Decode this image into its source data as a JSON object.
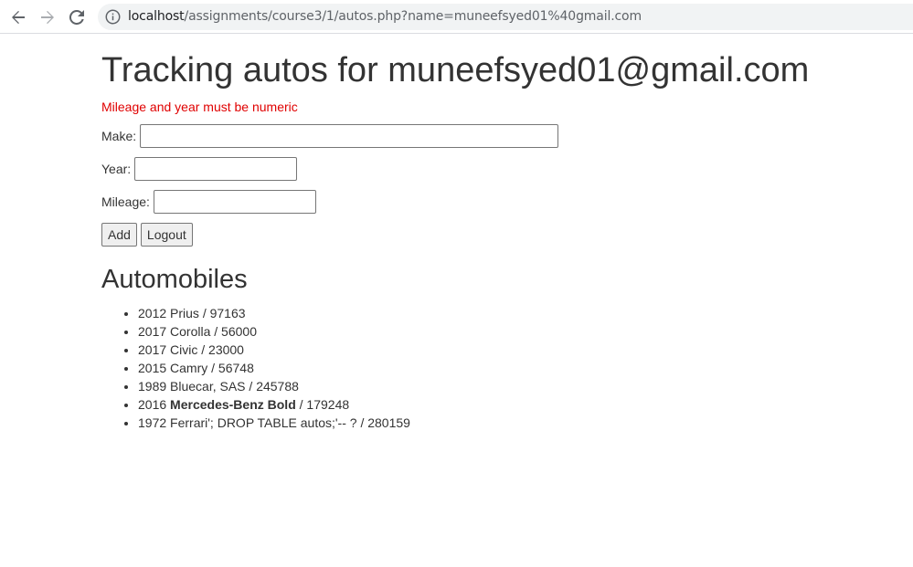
{
  "browser": {
    "url_host": "localhost",
    "url_path": "/assignments/course3/1/autos.php?name=muneefsyed01%40gmail.com"
  },
  "page": {
    "title": "Tracking autos for muneefsyed01@gmail.com",
    "error_message": "Mileage and year must be numeric",
    "error_color": "#e00000"
  },
  "form": {
    "make_label": "Make:",
    "make_value": "",
    "year_label": "Year:",
    "year_value": "",
    "mileage_label": "Mileage:",
    "mileage_value": "",
    "add_button": "Add",
    "logout_button": "Logout"
  },
  "automobiles": {
    "heading": "Automobiles",
    "items": [
      {
        "before": "2012 Prius / 97163",
        "bold": "",
        "after": ""
      },
      {
        "before": "2017 Corolla / 56000",
        "bold": "",
        "after": ""
      },
      {
        "before": "2017 Civic / 23000",
        "bold": "",
        "after": ""
      },
      {
        "before": "2015 Camry / 56748",
        "bold": "",
        "after": ""
      },
      {
        "before": "1989 Bluecar, SAS / 245788",
        "bold": "",
        "after": ""
      },
      {
        "before": "2016 ",
        "bold": "Mercedes-Benz Bold",
        "after": " / 179248"
      },
      {
        "before": "1972 Ferrari'; DROP TABLE autos;'-- ? / 280159",
        "bold": "",
        "after": ""
      }
    ]
  }
}
